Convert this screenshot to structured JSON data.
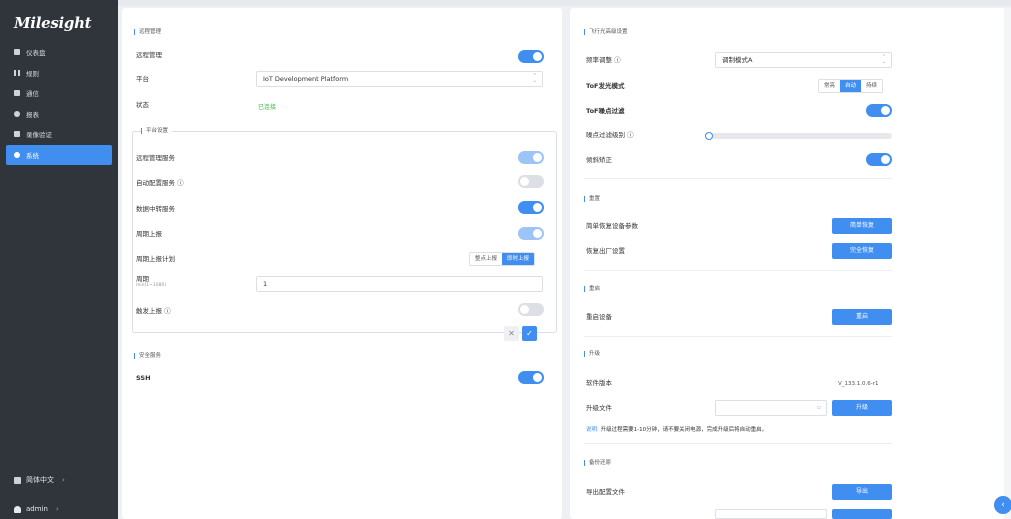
{
  "brand": {
    "logo": "Milesight"
  },
  "sidebar": {
    "items": [
      {
        "label": "仪表盘",
        "icon": "dashboard-icon"
      },
      {
        "label": "规则",
        "icon": "rules-icon"
      },
      {
        "label": "通信",
        "icon": "communication-icon"
      },
      {
        "label": "报表",
        "icon": "report-icon"
      },
      {
        "label": "录像验证",
        "icon": "video-verify-icon"
      },
      {
        "label": "系统",
        "icon": "system-icon",
        "active": true
      }
    ],
    "language": "简体中文",
    "user": "admin"
  },
  "left": {
    "remote": {
      "section": "远程管理",
      "remote_label": "远程管理",
      "platform_label": "平台",
      "platform_value": "IoT Development Platform",
      "status_label": "状态",
      "status_value": "已连接"
    },
    "platform_settings": {
      "section": "平台设置",
      "service_label": "远程管理服务",
      "auto_config_label": "自动配置服务 ⓘ",
      "data_relay_label": "数据中转服务",
      "periodic_label": "周期上报",
      "schedule_label": "周期上报计划",
      "schedule_options": [
        "整点上报",
        "即时上报"
      ],
      "period_label": "周期",
      "period_unit": "min(1~1080)",
      "period_value": "1",
      "trigger_label": "触发上报 ⓘ",
      "cancel_symbol": "✕",
      "confirm_symbol": "✓"
    },
    "security": {
      "section": "安全服务",
      "ssh_label": "SSH"
    }
  },
  "right": {
    "advanced": {
      "section": "飞行光高级设置",
      "freq_label": "频率调整 ⓘ",
      "freq_value": "调制模式A",
      "tof_mode_label": "ToF发光模式",
      "tof_mode_options": [
        "常亮",
        "自动",
        "持续"
      ],
      "tof_filter_label": "ToF噪点过滤",
      "noise_level_label": "噪点过滤级别 ⓘ",
      "noise_level_value": 0,
      "tilt_label": "倾斜矫正"
    },
    "reset": {
      "section": "重置",
      "simple_label": "简单恢复设备参数",
      "simple_btn": "简单恢复",
      "factory_label": "恢复出厂设置",
      "factory_btn": "完全恢复"
    },
    "reboot": {
      "section": "重启",
      "label": "重启设备",
      "btn": "重启"
    },
    "upgrade": {
      "section": "升级",
      "version_label": "软件版本",
      "version_value": "V_133.1.0.6-r1",
      "file_label": "升级文件",
      "file_btn": "升级",
      "note_prefix": "说明:",
      "note_text": "升级过程需要1-10分钟，请不要关闭电源，完成升级后将自动重启。"
    },
    "backup": {
      "section": "备份还原",
      "export_label": "导出配置文件",
      "export_btn": "导出"
    }
  },
  "float": {
    "symbol": "‹"
  },
  "colors": {
    "accent": "#3f8ef0",
    "sidebar": "#30343b",
    "success": "#47b54c"
  }
}
